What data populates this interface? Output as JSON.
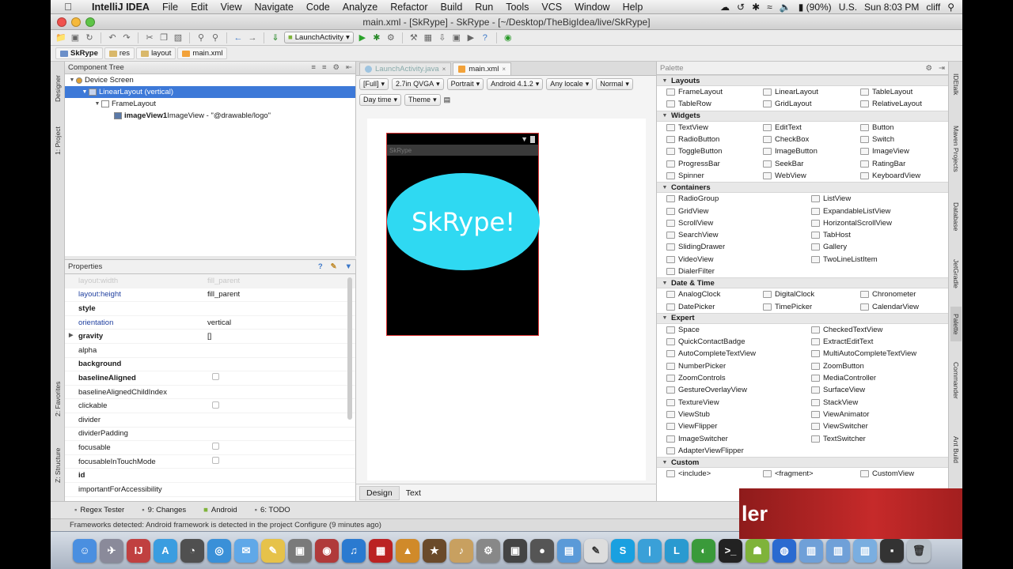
{
  "menubar": {
    "app": "IntelliJ IDEA",
    "items": [
      "File",
      "Edit",
      "View",
      "Navigate",
      "Code",
      "Analyze",
      "Refactor",
      "Build",
      "Run",
      "Tools",
      "VCS",
      "Window",
      "Help"
    ],
    "battery": "(90%)",
    "locale": "U.S.",
    "clock": "Sun 8:03 PM",
    "user": "cliff"
  },
  "window": {
    "title": "main.xml - [SkRype] - SkRype - [~/Desktop/TheBigIdea/live/SkRype]"
  },
  "toolbar": {
    "run_config": "LaunchActivity"
  },
  "breadcrumbs": [
    "SkRype",
    "res",
    "layout",
    "main.xml"
  ],
  "left_strip": {
    "designer": "Designer",
    "project": "1: Project",
    "favorites": "2: Favorites",
    "structure": "Z: Structure"
  },
  "right_strip": {
    "idetalk": "IDEtalk",
    "maven": "Maven Projects",
    "database": "Database",
    "jetgradle": "JetGradle",
    "palette": "Palette",
    "commander": "Commander",
    "ant": "Ant Build"
  },
  "component_tree": {
    "title": "Component Tree",
    "nodes": [
      {
        "label": "Device Screen",
        "depth": 0
      },
      {
        "label": "LinearLayout (vertical)",
        "depth": 1,
        "selected": true
      },
      {
        "label": "FrameLayout",
        "depth": 2
      },
      {
        "label": "imageView1",
        "detail": " ImageView - \"@drawable/logo\"",
        "depth": 3
      }
    ]
  },
  "properties": {
    "title": "Properties",
    "rows": [
      {
        "key": "layout:width",
        "value": "fill_parent",
        "style": "dim"
      },
      {
        "key": "layout:height",
        "value": "fill_parent",
        "style": "blue"
      },
      {
        "key": "style",
        "value": "",
        "style": "bold"
      },
      {
        "key": "orientation",
        "value": "vertical",
        "style": "blue"
      },
      {
        "key": "gravity",
        "value": "[]",
        "style": "bold",
        "expand": true
      },
      {
        "key": "alpha",
        "value": "",
        "style": ""
      },
      {
        "key": "background",
        "value": "",
        "style": "bold"
      },
      {
        "key": "baselineAligned",
        "value": "",
        "style": "bold",
        "check": true
      },
      {
        "key": "baselineAlignedChildIndex",
        "value": "",
        "style": ""
      },
      {
        "key": "clickable",
        "value": "",
        "style": "",
        "check": true
      },
      {
        "key": "divider",
        "value": "",
        "style": ""
      },
      {
        "key": "dividerPadding",
        "value": "",
        "style": ""
      },
      {
        "key": "focusable",
        "value": "",
        "style": "",
        "check": true
      },
      {
        "key": "focusableInTouchMode",
        "value": "",
        "style": "",
        "check": true
      },
      {
        "key": "id",
        "value": "",
        "style": "bold"
      },
      {
        "key": "importantForAccessibility",
        "value": "",
        "style": ""
      }
    ]
  },
  "editor": {
    "tabs": [
      {
        "label": "LaunchActivity.java",
        "active": false
      },
      {
        "label": "main.xml",
        "active": true
      }
    ],
    "dropdowns": [
      "[Full]",
      "2.7in QVGA",
      "Portrait",
      "Android 4.1.2",
      "Any locale",
      "Normal"
    ],
    "dropdowns2": [
      "Day time",
      "Theme"
    ],
    "device_title": "SkRype",
    "logo_text": "SkRype!",
    "bottom_tabs": [
      {
        "label": "Design",
        "active": true
      },
      {
        "label": "Text",
        "active": false
      }
    ]
  },
  "palette": {
    "title": "Palette",
    "categories": [
      {
        "name": "Layouts",
        "rows": [
          [
            "FrameLayout",
            "LinearLayout",
            "TableLayout"
          ],
          [
            "TableRow",
            "GridLayout",
            "RelativeLayout"
          ]
        ]
      },
      {
        "name": "Widgets",
        "rows": [
          [
            "TextView",
            "EditText",
            "Button"
          ],
          [
            "RadioButton",
            "CheckBox",
            "Switch"
          ],
          [
            "ToggleButton",
            "ImageButton",
            "ImageView"
          ],
          [
            "ProgressBar",
            "SeekBar",
            "RatingBar"
          ],
          [
            "Spinner",
            "WebView",
            "KeyboardView"
          ]
        ]
      },
      {
        "name": "Containers",
        "wide": true,
        "rows": [
          [
            "RadioGroup",
            "ListView"
          ],
          [
            "GridView",
            "ExpandableListView"
          ],
          [
            "ScrollView",
            "HorizontalScrollView"
          ],
          [
            "SearchView",
            "TabHost"
          ],
          [
            "SlidingDrawer",
            "Gallery"
          ],
          [
            "VideoView",
            "TwoLineListItem"
          ],
          [
            "DialerFilter",
            ""
          ]
        ]
      },
      {
        "name": "Date & Time",
        "rows": [
          [
            "AnalogClock",
            "DigitalClock",
            "Chronometer"
          ],
          [
            "DatePicker",
            "TimePicker",
            "CalendarView"
          ]
        ]
      },
      {
        "name": "Expert",
        "wide": true,
        "rows": [
          [
            "Space",
            "CheckedTextView"
          ],
          [
            "QuickContactBadge",
            "ExtractEditText"
          ],
          [
            "AutoCompleteTextView",
            "MultiAutoCompleteTextView"
          ],
          [
            "NumberPicker",
            "ZoomButton"
          ],
          [
            "ZoomControls",
            "MediaController"
          ],
          [
            "GestureOverlayView",
            "SurfaceView"
          ],
          [
            "TextureView",
            "StackView"
          ],
          [
            "ViewStub",
            "ViewAnimator"
          ],
          [
            "ViewFlipper",
            "ViewSwitcher"
          ],
          [
            "ImageSwitcher",
            "TextSwitcher"
          ],
          [
            "AdapterViewFlipper",
            ""
          ]
        ]
      },
      {
        "name": "Custom",
        "rows": [
          [
            "<include>",
            "<fragment>",
            "CustomView"
          ]
        ]
      }
    ]
  },
  "bottom_tools": [
    "Regex Tester",
    "9: Changes",
    "Android",
    "6: TODO"
  ],
  "statusbar": "Frameworks detected: Android framework is detected in the project Configure (9 minutes ago)",
  "banner": "ler",
  "colors": {
    "selection": "#3d79d8",
    "logo": "#2fd9f2",
    "banner": "#c62a2a"
  }
}
